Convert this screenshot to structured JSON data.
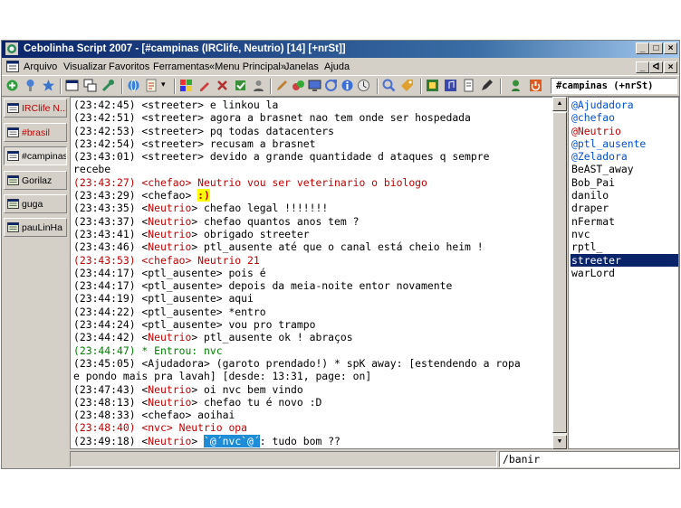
{
  "window": {
    "title": "Cebolinha Script 2007 - [#campinas (IRClife, Neutrio) [14] [+nrSt]]",
    "controls": [
      "_",
      "□",
      "×"
    ],
    "mdi_controls": [
      "_",
      "ᐊ",
      "×"
    ]
  },
  "menu": [
    "Arquivo",
    "Visualizar",
    "Favoritos",
    "Ferramentas",
    "«Menu Principal»",
    "Janelas",
    "Ajuda"
  ],
  "toolbar": {
    "channel_label": "#campinas (+nrSt)",
    "icons": [
      "connect-icon",
      "options-icon",
      "favorites-icon",
      "window-icon",
      "tile-icon",
      "tools-icon",
      "web-icon",
      "script-icon",
      "colors-icon",
      "edit-icon",
      "find-icon",
      "gear-icon",
      "pen-icon",
      "users-icon",
      "image-icon",
      "refresh-icon",
      "info-icon",
      "away-icon",
      "search-icon",
      "tag-icon",
      "app-icon",
      "music-icon",
      "note-icon",
      "pencil-icon",
      "status-icon",
      "power-icon"
    ]
  },
  "sidebar": [
    {
      "label": "IRClife N...",
      "color": "#c00000",
      "icon": "server-icon"
    },
    {
      "label": "#brasil",
      "color": "#c00000",
      "icon": "channel-icon"
    },
    {
      "label": "#campinas",
      "color": "#000000",
      "icon": "channel-icon",
      "active": true
    },
    {
      "label": "Gorilaz",
      "color": "#000000",
      "icon": "query-icon"
    },
    {
      "label": "guga",
      "color": "#000000",
      "icon": "query-icon"
    },
    {
      "label": "pauLinHa",
      "color": "#000000",
      "icon": "query-icon"
    }
  ],
  "chat": {
    "lines": [
      {
        "text": "(23:42:45) <streeter> e linkou la",
        "style": "norm"
      },
      {
        "text": "(23:42:51) <streeter> agora a brasnet nao tem onde ser hospedada",
        "style": "norm"
      },
      {
        "text": "(23:42:53) <streeter> pq todas datacenters",
        "style": "norm"
      },
      {
        "text": "(23:42:54) <streeter> recusam a brasnet",
        "style": "norm"
      },
      {
        "text": "(23:43:01) <streeter> devido a grande quantidade d ataques q sempre",
        "style": "norm"
      },
      {
        "text": "  recebe",
        "style": "norm"
      },
      {
        "text": "(23:43:27) <chefao> Neutrio vou ser veterinario o biologo",
        "style": "red"
      },
      {
        "text": "(23:43:29) <chefao> ",
        "style": "norm",
        "smiley": ":)"
      },
      {
        "pre": "(23:43:35) <",
        "nick": "Neutrio",
        "text": "> chefao legal !!!!!!!",
        "style": "norm"
      },
      {
        "pre": "(23:43:37) <",
        "nick": "Neutrio",
        "text": "> chefao quantos anos tem ?",
        "style": "norm"
      },
      {
        "pre": "(23:43:41) <",
        "nick": "Neutrio",
        "text": "> obrigado streeter",
        "style": "norm"
      },
      {
        "pre": "(23:43:46) <",
        "nick": "Neutrio",
        "text": "> ptl_ausente até que o canal está cheio heim !",
        "style": "norm"
      },
      {
        "text": "(23:43:53) <chefao> Neutrio 21",
        "style": "red"
      },
      {
        "text": "(23:44:17) <ptl_ausente> pois é",
        "style": "norm"
      },
      {
        "text": "(23:44:17) <ptl_ausente> depois da meia-noite entor novamente",
        "style": "norm"
      },
      {
        "text": "(23:44:19) <ptl_ausente> aqui",
        "style": "norm"
      },
      {
        "text": "(23:44:22) <ptl_ausente> *entro",
        "style": "norm"
      },
      {
        "text": "(23:44:24) <ptl_ausente> vou pro trampo",
        "style": "norm"
      },
      {
        "pre": "(23:44:42) <",
        "nick": "Neutrio",
        "text": "> ptl_ausente ok ! abraços",
        "style": "norm"
      },
      {
        "text": "(23:44:47) * Entrou: nvc",
        "style": "green"
      },
      {
        "text": "(23:45:05) <Ajudadora> (garoto prendado!) * spK away: [estendendo a ropa",
        "style": "norm"
      },
      {
        "text": "  e pondo mais pra lavah] [desde: 13:31, page: on]",
        "style": "norm"
      },
      {
        "pre": "(23:47:43) <",
        "nick": "Neutrio",
        "text": "> oi nvc bem vindo",
        "style": "norm"
      },
      {
        "pre": "(23:48:13) <",
        "nick": "Neutrio",
        "text": "> chefao tu é novo :D",
        "style": "norm"
      },
      {
        "text": "(23:48:33) <chefao> aoihai",
        "style": "norm"
      },
      {
        "text": "(23:48:40) <nvc> Neutrio opa",
        "style": "red"
      },
      {
        "pre": "(23:49:18) <",
        "nick": "Neutrio",
        "text": "> ",
        "style": "norm",
        "hlnick": "`@´nvc`@´",
        "post": ": tudo bom ??"
      }
    ]
  },
  "nicklist": [
    {
      "nick": "@Ajudadora",
      "style": "op"
    },
    {
      "nick": "@chefao",
      "style": "op"
    },
    {
      "nick": "@Neutrio",
      "style": "opred"
    },
    {
      "nick": "@ptl_ausente",
      "style": "op"
    },
    {
      "nick": "@Zeladora",
      "style": "op"
    },
    {
      "nick": "BeAST_away",
      "style": "norm"
    },
    {
      "nick": "Bob_Pai",
      "style": "norm"
    },
    {
      "nick": "danilo",
      "style": "norm"
    },
    {
      "nick": "draper",
      "style": "norm"
    },
    {
      "nick": "nFermat",
      "style": "norm"
    },
    {
      "nick": "nvc",
      "style": "norm"
    },
    {
      "nick": "rptl_",
      "style": "norm"
    },
    {
      "nick": "streeter",
      "style": "sel"
    },
    {
      "nick": "warLord",
      "style": "norm"
    }
  ],
  "input": {
    "value": "",
    "command": "/banir"
  },
  "colors": {
    "title_start": "#0a246a",
    "title_end": "#a6caf0",
    "nick_red": "#c00000",
    "op_blue": "#0050d0",
    "join_green": "#008000",
    "selection": "#0a246a"
  }
}
